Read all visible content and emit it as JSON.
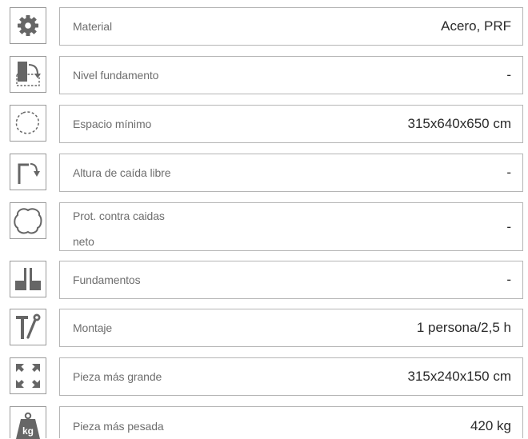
{
  "specs": [
    {
      "icon": "gear-icon",
      "label": "Material",
      "value": "Acero, PRF"
    },
    {
      "icon": "foundation-level-icon",
      "label": "Nivel fundamento",
      "value": "-"
    },
    {
      "icon": "minimum-space-icon",
      "label": "Espacio mínimo",
      "value": "315x640x650 cm"
    },
    {
      "icon": "free-fall-height-icon",
      "label": "Altura de caída libre",
      "value": "-"
    },
    {
      "icon": "fall-protection-icon",
      "label_line1": "Prot. contra caidas",
      "label_line2": "neto",
      "value": "-"
    },
    {
      "icon": "foundations-icon",
      "label": "Fundamentos",
      "value": "-"
    },
    {
      "icon": "tools-icon",
      "label": "Montaje",
      "value": "1 persona/2,5 h"
    },
    {
      "icon": "expand-arrows-icon",
      "label": "Pieza más grande",
      "value": "315x240x150 cm"
    },
    {
      "icon": "weight-kg-icon",
      "label": "Pieza más pesada",
      "value": "420 kg",
      "icon_text": "kg"
    }
  ],
  "colors": {
    "icon_fill": "#666666",
    "border": "#b5b5b5",
    "label": "#6e6e6e",
    "value": "#2a2a2a"
  }
}
